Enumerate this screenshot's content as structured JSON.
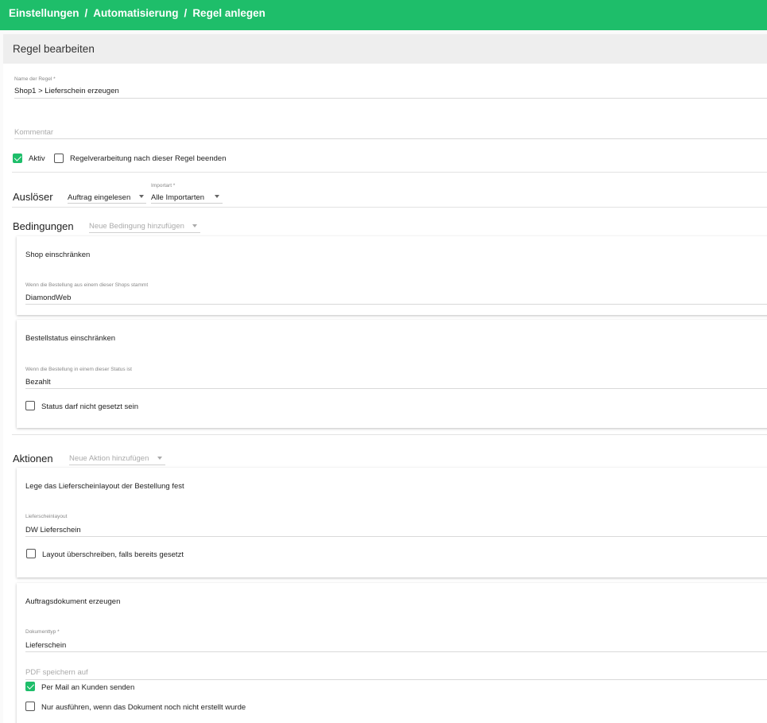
{
  "colors": {
    "accent": "#1ebe6a"
  },
  "breadcrumb": {
    "items": [
      "Einstellungen",
      "Automatisierung",
      "Regel anlegen"
    ],
    "separator": "/"
  },
  "card": {
    "title": "Regel bearbeiten"
  },
  "form": {
    "name": {
      "label": "Name der Regel *",
      "value": "Shop1 > Lieferschein erzeugen"
    },
    "comment": {
      "placeholder": "Kommentar"
    },
    "active": {
      "label": "Aktiv",
      "checked": true
    },
    "stop_processing": {
      "label": "Regelverarbeitung nach dieser Regel beenden",
      "checked": false
    }
  },
  "trigger": {
    "title": "Auslöser",
    "event": {
      "value": "Auftrag eingelesen"
    },
    "import_type": {
      "label": "Importart *",
      "value": "Alle Importarten"
    }
  },
  "conditions": {
    "title": "Bedingungen",
    "add_placeholder": "Neue Bedingung hinzufügen",
    "items": [
      {
        "title": "Shop einschränken",
        "field_label": "Wenn die Bestellung aus einem dieser Shops stammt",
        "value": "DiamondWeb"
      },
      {
        "title": "Bestellstatus einschränken",
        "field_label": "Wenn die Bestellung in einem dieser Status ist",
        "value": "Bezahlt",
        "checkbox_label": "Status darf nicht gesetzt sein",
        "checked": false
      }
    ]
  },
  "actions": {
    "title": "Aktionen",
    "add_placeholder": "Neue Aktion hinzufügen",
    "items": [
      {
        "title": "Lege das Lieferscheinlayout der Bestellung fest",
        "field_label": "Lieferscheinlayout",
        "value": "DW Lieferschein",
        "checkbox_label": "Layout überschreiben, falls bereits gesetzt",
        "checked": false
      },
      {
        "title": "Auftragsdokument erzeugen",
        "field_label": "Dokumenttyp *",
        "value": "Lieferschein",
        "pdf_placeholder": "PDF speichern auf",
        "mail": {
          "label": "Per Mail an Kunden senden",
          "checked": true
        },
        "only_once": {
          "label": "Nur ausführen, wenn das Dokument noch nicht erstellt wurde",
          "checked": false
        }
      }
    ]
  }
}
